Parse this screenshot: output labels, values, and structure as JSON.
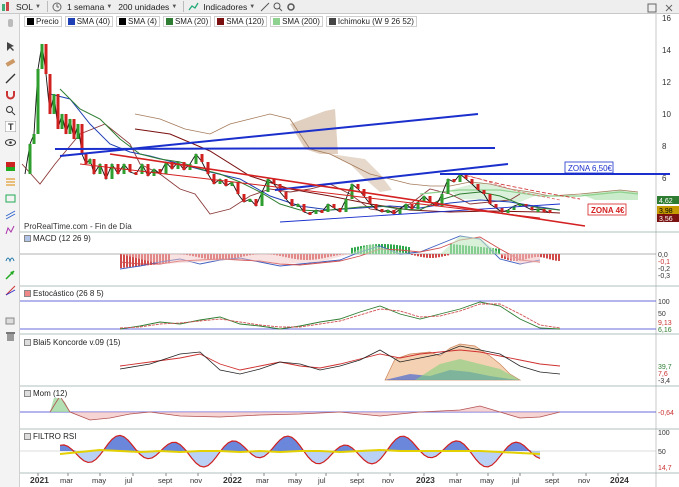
{
  "toolbar": {
    "ticker": "SOL",
    "timeframe": "1 semana",
    "units": "200 unidades",
    "indicators": "Indicadores"
  },
  "legend": [
    {
      "label": "Precio",
      "color": "#000000"
    },
    {
      "label": "SMA (40)",
      "color": "#1f3fb5"
    },
    {
      "label": "SMA (4)",
      "color": "#000000"
    },
    {
      "label": "SMA (20)",
      "color": "#2e7d32"
    },
    {
      "label": "SMA (120)",
      "color": "#7a1010"
    },
    {
      "label": "SMA (200)",
      "color": "#8fd18f"
    },
    {
      "label": "Ichimoku (W 9 26 52)",
      "color": "#444444"
    }
  ],
  "source_note": "ProRealTime.com - Fin de Día",
  "zones": {
    "upper": "ZONA 6,50€",
    "lower": "ZONA 4€"
  },
  "price_axis": [
    "16",
    "14",
    "12",
    "10",
    "8",
    "6",
    "4"
  ],
  "price_tags": [
    "4,62",
    "3,98",
    "3,56"
  ],
  "panels": {
    "macd": {
      "title": "MACD (12 26 9)",
      "axis": [
        "0,0",
        "-0,1",
        "-0,2",
        "-0,3"
      ]
    },
    "stochastic": {
      "title": "Estocástico (26 8 5)",
      "axis": [
        "100",
        "50",
        "9,13",
        "6,16"
      ]
    },
    "koncorde": {
      "title": "Blai5 Koncorde v.09 (15)",
      "axis": [
        "39,7",
        "7,6",
        "-3,4"
      ]
    },
    "momentum": {
      "title": "Mom (12)",
      "axis": [
        "-0,64"
      ]
    },
    "rsi": {
      "title": "FILTRO RSI",
      "axis": [
        "100",
        "50",
        "14,7"
      ]
    }
  },
  "x_axis": [
    "2021",
    "mar",
    "may",
    "jul",
    "sept",
    "nov",
    "2022",
    "mar",
    "may",
    "jul",
    "sept",
    "nov",
    "2023",
    "mar",
    "may",
    "jul",
    "sept",
    "nov",
    "2024"
  ],
  "chart_data": {
    "type": "line",
    "title": "",
    "series": [
      {
        "name": "Precio",
        "values": [
          10.5,
          13.2,
          9.0,
          8.0,
          6.5,
          7.2,
          6.8,
          6.5,
          7.5,
          5.8,
          4.7,
          4.4,
          3.7,
          3.9,
          3.6,
          4.5,
          3.9,
          4.6,
          5.2,
          6.2,
          5.6,
          4.4,
          4.2,
          3.98
        ]
      }
    ],
    "annotations": [
      "ZONA 6,50€",
      "ZONA 4€"
    ]
  }
}
